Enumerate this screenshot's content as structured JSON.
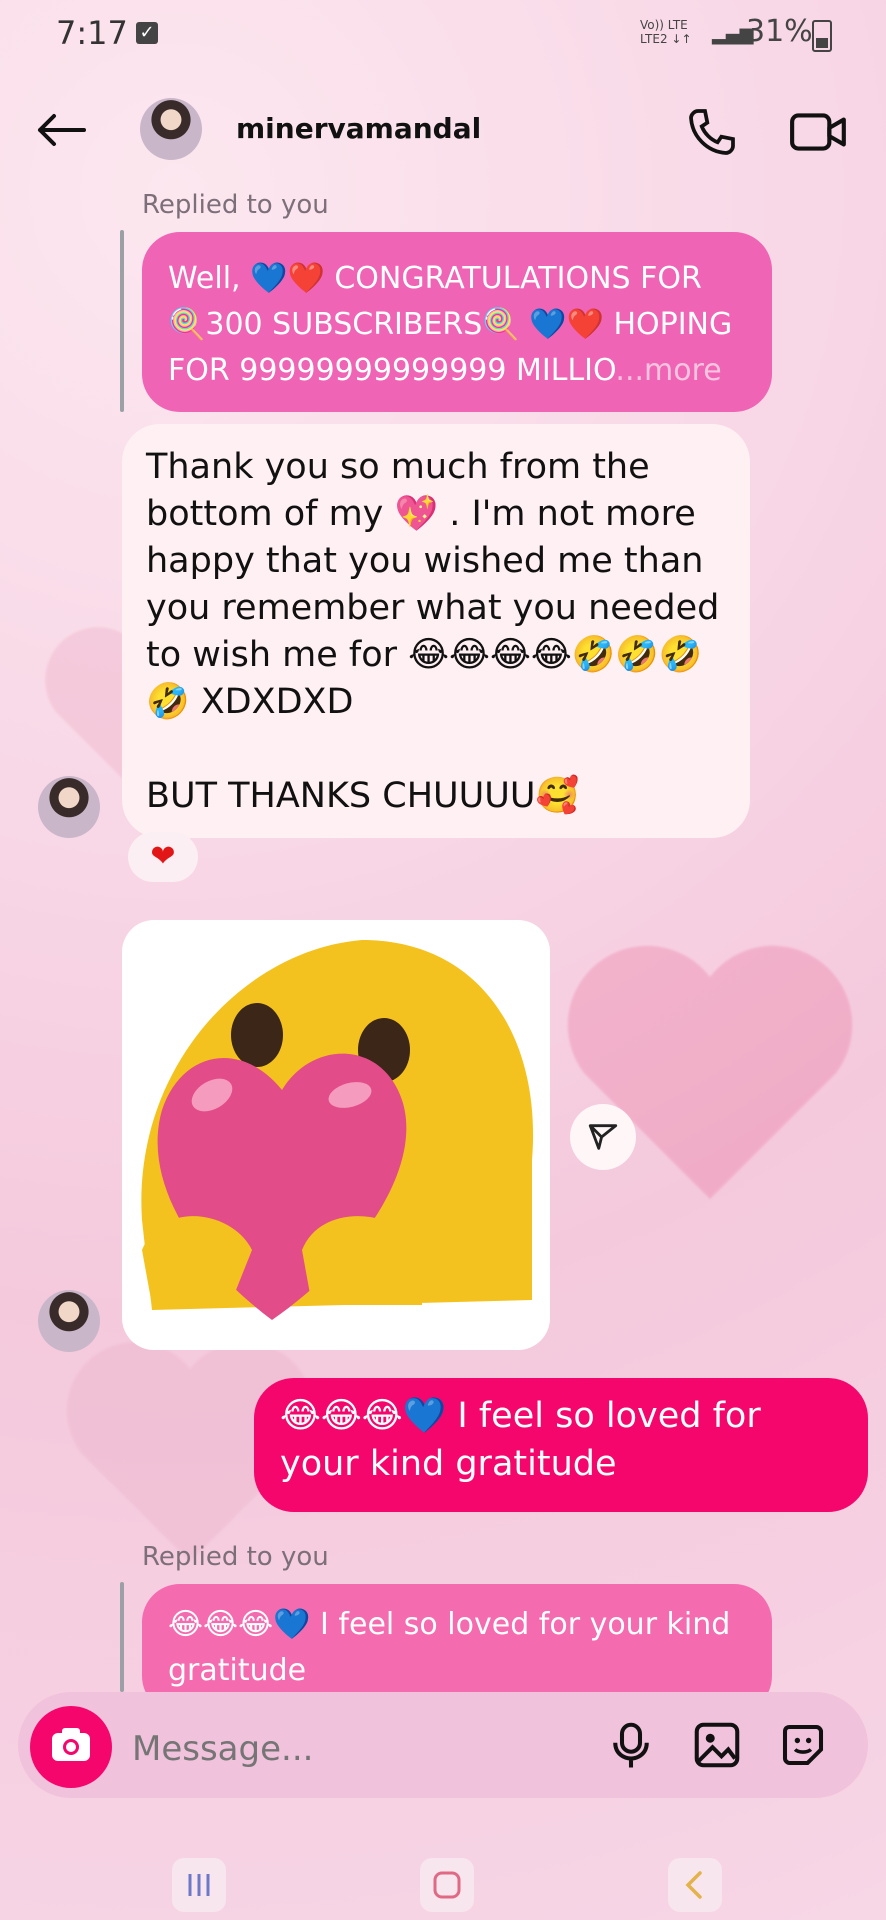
{
  "status": {
    "time": "7:17",
    "network_lines": [
      "Vo)) LTE",
      "LTE2 ↓↑"
    ],
    "battery": "31%"
  },
  "header": {
    "username": "minervamandal"
  },
  "messages": {
    "reply_label_1": "Replied to you",
    "reply_bubble_1": "Well, 💙❤️ CONGRATULATIONS FOR 🍭300 SUBSCRIBERS🍭 💙❤️ HOPING FOR 99999999999999 MILLIO",
    "reply_more": "...more",
    "thank_you": "Thank you so much from the bottom of my 💖 . I'm not more happy that you wished me than you remember what you needed to wish me for 😂😂😂😂🤣🤣🤣🤣 XDXDXD",
    "thanks_chuu": "BUT THANKS CHUUUU🥰",
    "reaction": "❤",
    "my_message": "😂😂😂💙 I feel so loved for your kind gratitude",
    "reply_label_2": "Replied to you",
    "reply_bubble_2": "😂😂😂💙 I feel so loved for your kind gratitude"
  },
  "composer": {
    "placeholder": "Message..."
  },
  "colors": {
    "accent": "#f4066c",
    "pink_bubble": "#ef64b5",
    "white_bubble": "#fff0f3"
  },
  "icons": [
    "back-arrow-icon",
    "phone-icon",
    "video-camera-icon",
    "send-icon",
    "camera-icon",
    "microphone-icon",
    "image-icon",
    "sticker-icon",
    "recent-apps-icon",
    "home-icon",
    "back-nav-icon"
  ]
}
